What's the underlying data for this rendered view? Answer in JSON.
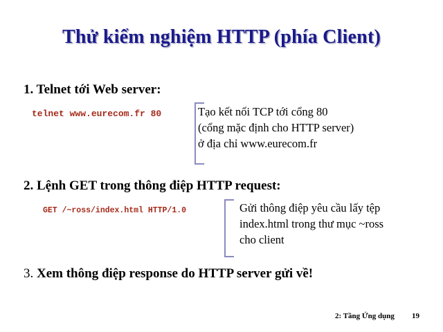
{
  "slide": {
    "title": "Thử kiểm nghiệm HTTP (phía Client)",
    "step1": {
      "heading": "1. Telnet tới Web server:",
      "command": "telnet www.eurecom.fr 80",
      "note": [
        "Tạo kết nối TCP tới cổng 80",
        "(cổng mặc định cho HTTP server)",
        "ở địa chỉ www.eurecom.fr"
      ]
    },
    "step2": {
      "heading": "2. Lệnh GET trong thông điệp HTTP request:",
      "command": "GET /~ross/index.html HTTP/1.0",
      "note": [
        "Gửi thông điệp yêu cầu lấy tệp",
        "index.html trong thư mục ~ross",
        "cho client"
      ]
    },
    "step3": {
      "number": "3.",
      "heading": "Xem thông điệp response do HTTP server gửi về!"
    },
    "footer": {
      "label": "2: Tầng Ứng dụng",
      "page_number": "19"
    },
    "colors": {
      "title": "#1a1a8c",
      "command": "#a52a1a",
      "bracket": "#8a8abf"
    }
  }
}
